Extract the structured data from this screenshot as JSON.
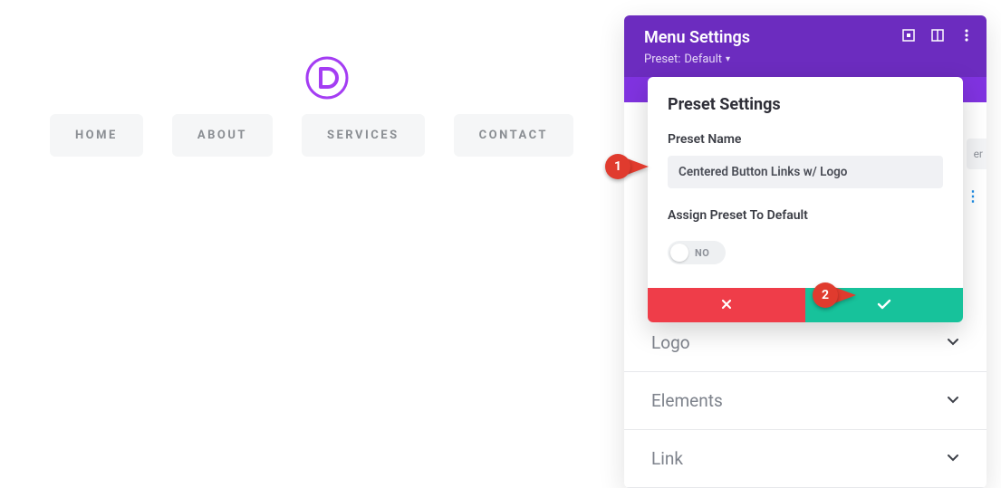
{
  "nav": {
    "items": [
      {
        "label": "HOME"
      },
      {
        "label": "ABOUT"
      },
      {
        "label": "SERVICES"
      },
      {
        "label": "CONTACT"
      }
    ]
  },
  "panel": {
    "title": "Menu Settings",
    "preset_prefix": "Preset:",
    "preset_value": "Default"
  },
  "preset_card": {
    "title": "Preset Settings",
    "name_label": "Preset Name",
    "name_value": "Centered Button Links w/ Logo",
    "assign_label": "Assign Preset To Default",
    "toggle_text": "NO"
  },
  "sections": {
    "logo": "Logo",
    "elements": "Elements",
    "link": "Link"
  },
  "background_fragment": "er",
  "callouts": {
    "one": "1",
    "two": "2"
  }
}
